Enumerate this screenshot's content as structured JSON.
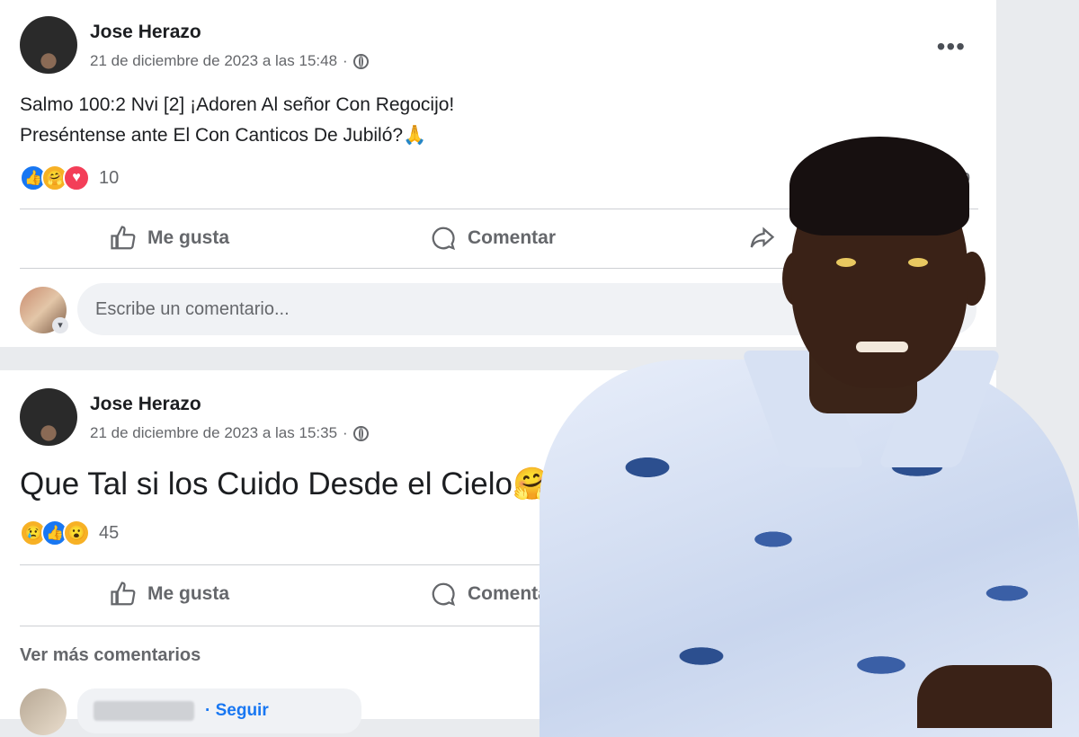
{
  "posts": [
    {
      "author": "Jose Herazo",
      "timestamp": "21 de diciembre de 2023 a las 15:48",
      "text_line1": "Salmo 100:2 Nvi [2] ¡Adoren Al señor Con Regocijo!",
      "text_line2": "Preséntense ante El Con Canticos De Jubiló?🙏",
      "reaction_count": "10",
      "reactions": [
        "like",
        "care",
        "love"
      ],
      "actions": {
        "like": "Me gusta",
        "comment": "Comentar"
      },
      "comment_placeholder": "Escribe un comentario...",
      "partial_right_text": "o"
    },
    {
      "author": "Jose Herazo",
      "timestamp": "21 de diciembre de 2023 a las 15:35",
      "text": "Que Tal si los Cuido Desde el Cielo🤗",
      "reaction_count": "45",
      "reactions": [
        "sad",
        "like",
        "wow"
      ],
      "actions": {
        "like": "Me gusta",
        "comment": "Comentar"
      }
    }
  ],
  "more_comments": "Ver más comentarios",
  "follow_label": "· Seguir",
  "more_icon": "•••",
  "colors": {
    "accent": "#1877f2",
    "secondary_text": "#65676b",
    "background": "#e9ebee"
  }
}
